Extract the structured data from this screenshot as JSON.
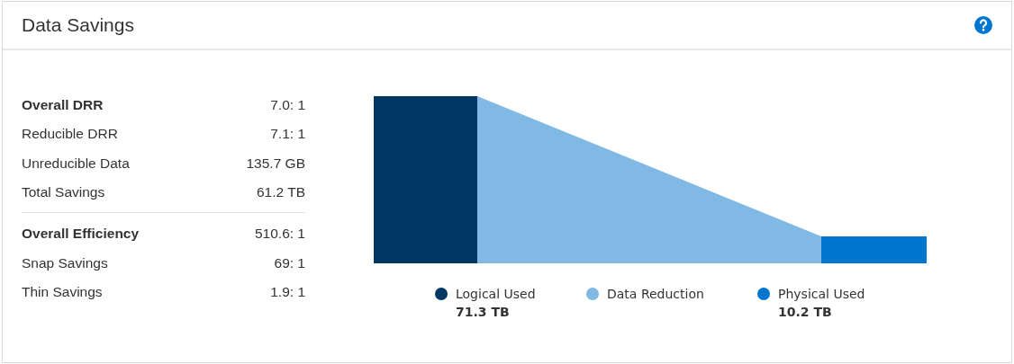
{
  "panel": {
    "title": "Data Savings"
  },
  "stat_groups": [
    {
      "rows": [
        {
          "label": "Overall DRR",
          "value": "7.0: 1",
          "bold": true
        },
        {
          "label": "Reducible DRR",
          "value": "7.1: 1",
          "bold": false
        },
        {
          "label": "Unreducible Data",
          "value": "135.7 GB",
          "bold": false
        },
        {
          "label": "Total Savings",
          "value": "61.2 TB",
          "bold": false
        }
      ]
    },
    {
      "rows": [
        {
          "label": "Overall Efficiency",
          "value": "510.6: 1",
          "bold": true
        },
        {
          "label": "Snap Savings",
          "value": "69: 1",
          "bold": false
        },
        {
          "label": "Thin Savings",
          "value": "1.9: 1",
          "bold": false
        }
      ]
    }
  ],
  "legend": [
    {
      "label": "Logical Used",
      "value": "71.3 TB",
      "color": "#003865"
    },
    {
      "label": "Data Reduction",
      "color": "#7fb9e4"
    },
    {
      "label": "Physical Used",
      "value": "10.2 TB",
      "color": "#0076ce"
    }
  ]
}
